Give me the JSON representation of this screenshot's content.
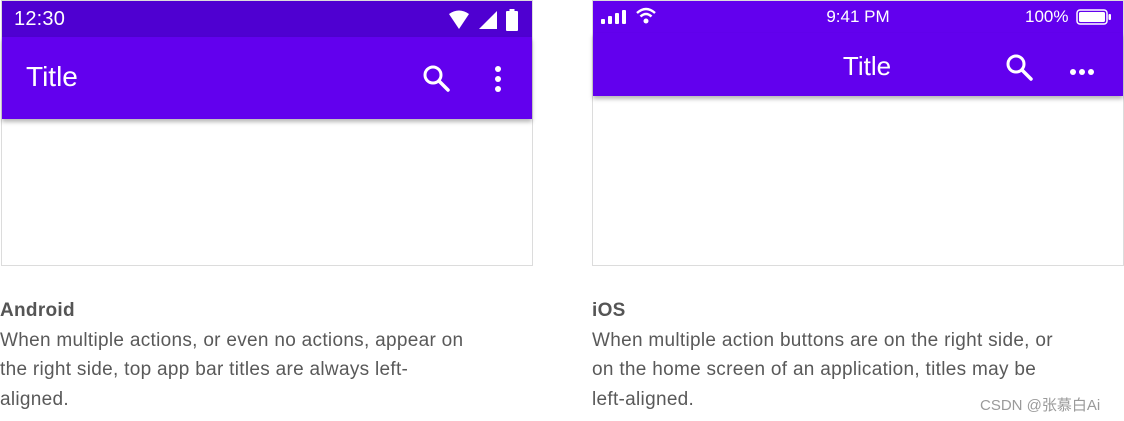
{
  "android": {
    "status_time": "12:30",
    "title": "Title",
    "colors": {
      "status_bar": "#4f00d1",
      "app_bar": "#6200ee"
    },
    "icons": [
      "wifi-icon",
      "cell-signal-icon",
      "battery-icon",
      "search-icon",
      "more-vert-icon"
    ]
  },
  "ios": {
    "status_time": "9:41 PM",
    "battery_percent": "100%",
    "title": "Title",
    "colors": {
      "app_bar": "#6200ee"
    },
    "icons": [
      "cell-signal-icon",
      "wifi-icon",
      "battery-icon",
      "search-icon",
      "more-horiz-icon"
    ]
  },
  "captions": {
    "android": {
      "heading": "Android",
      "lines": [
        "When multiple actions, or even no actions, appear on",
        "the right side, top app bar titles are always left-",
        "aligned."
      ]
    },
    "ios": {
      "heading": "iOS",
      "lines": [
        "When multiple action buttons are on the right side, or",
        "on the home screen of an application, titles may be",
        "left-aligned."
      ]
    }
  },
  "watermark": "CSDN @张慕白Ai"
}
